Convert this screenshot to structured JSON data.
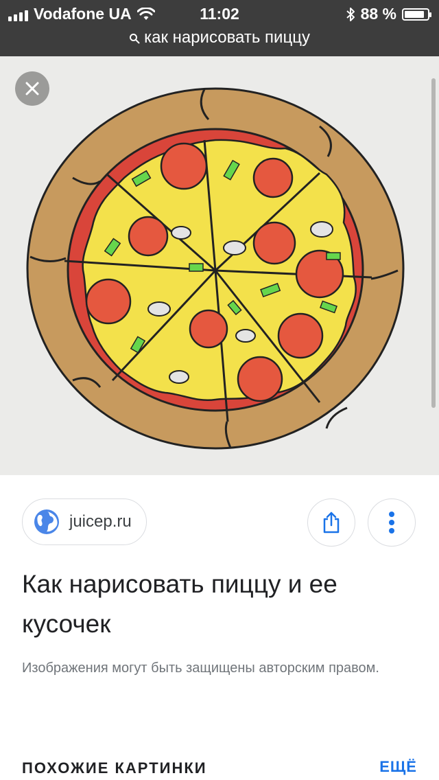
{
  "status_bar": {
    "carrier": "Vodafone UA",
    "time": "11:02",
    "battery_percent": "88 %",
    "battery_level": 0.88,
    "signal_icon": "signal-bars-icon",
    "wifi_icon": "wifi-icon",
    "bluetooth_icon": "bluetooth-icon"
  },
  "url_bar": {
    "query": "как нарисовать пиццу",
    "search_icon": "search-icon"
  },
  "viewer": {
    "close_icon": "close-icon"
  },
  "result": {
    "source_domain": "juicep.ru",
    "title": "Как нарисовать пиццу и ее кусочек",
    "copyright_note": "Изображения могут быть защищены авторским правом."
  },
  "actions": {
    "share_icon": "share-icon",
    "more_icon": "more-vert-icon"
  },
  "similar_section": {
    "heading": "ПОХОЖИЕ КАРТИНКИ",
    "more_label": "ЕЩЁ"
  },
  "colors": {
    "status_bar_bg": "#3d3d3d",
    "accent_blue": "#1a73e8",
    "viewer_bg": "#ebebe9"
  }
}
